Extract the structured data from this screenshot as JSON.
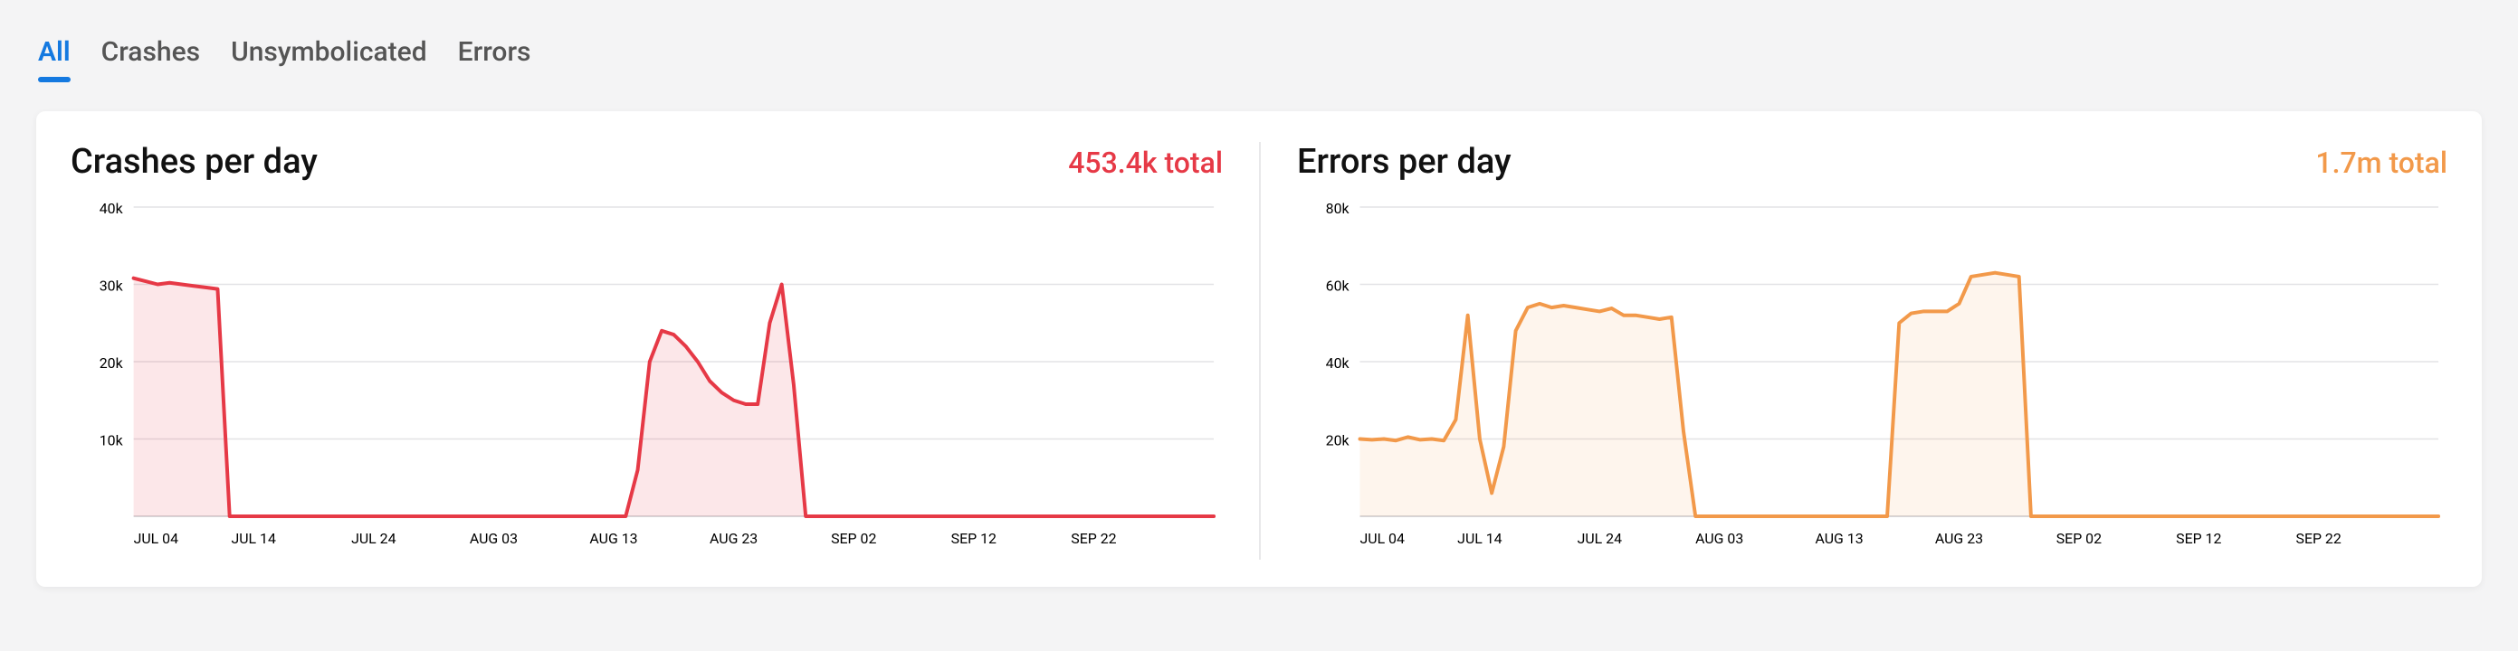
{
  "tabs": {
    "items": [
      {
        "label": "All",
        "active": true
      },
      {
        "label": "Crashes",
        "active": false
      },
      {
        "label": "Unsymbolicated",
        "active": false
      },
      {
        "label": "Errors",
        "active": false
      }
    ]
  },
  "colors": {
    "crashes_stroke": "#e63946",
    "crashes_fill": "rgba(230,57,70,0.12)",
    "errors_stroke": "#f2994a",
    "errors_fill": "rgba(242,153,74,0.10)",
    "tab_active": "#1479e0"
  },
  "chart_data": [
    {
      "id": "crashes",
      "type": "area",
      "title": "Crashes per day",
      "total_label": "453.4k total",
      "total_color": "#e63946",
      "ylim": [
        0,
        40000
      ],
      "yticks": [
        {
          "v": 10000,
          "label": "10k"
        },
        {
          "v": 20000,
          "label": "20k"
        },
        {
          "v": 30000,
          "label": "30k"
        },
        {
          "v": 40000,
          "label": "40k"
        }
      ],
      "xticks": [
        "JUL 04",
        "JUL 14",
        "JUL 24",
        "AUG 03",
        "AUG 13",
        "AUG 23",
        "SEP 02",
        "SEP 12",
        "SEP 22"
      ],
      "xmax_index": 90,
      "series": [
        {
          "name": "Crashes",
          "values": [
            30800,
            30400,
            30000,
            30200,
            30000,
            29800,
            29600,
            29400,
            0,
            0,
            0,
            0,
            0,
            0,
            0,
            0,
            0,
            0,
            0,
            0,
            0,
            0,
            0,
            0,
            0,
            0,
            0,
            0,
            0,
            0,
            0,
            0,
            0,
            0,
            0,
            0,
            0,
            0,
            0,
            0,
            0,
            0,
            6000,
            20000,
            24000,
            23500,
            22000,
            20000,
            17500,
            16000,
            15000,
            14500,
            14500,
            25000,
            30000,
            17000,
            0,
            0,
            0,
            0,
            0,
            0,
            0,
            0,
            0,
            0,
            0,
            0,
            0,
            0,
            0,
            0,
            0,
            0,
            0,
            0,
            0,
            0,
            0,
            0,
            0,
            0,
            0,
            0,
            0,
            0,
            0,
            0,
            0,
            0,
            0
          ]
        }
      ]
    },
    {
      "id": "errors",
      "type": "area",
      "title": "Errors per day",
      "total_label": "1.7m total",
      "total_color": "#f2994a",
      "ylim": [
        0,
        80000
      ],
      "yticks": [
        {
          "v": 20000,
          "label": "20k"
        },
        {
          "v": 40000,
          "label": "40k"
        },
        {
          "v": 60000,
          "label": "60k"
        },
        {
          "v": 80000,
          "label": "80k"
        }
      ],
      "xticks": [
        "JUL 04",
        "JUL 14",
        "JUL 24",
        "AUG 03",
        "AUG 13",
        "AUG 23",
        "SEP 02",
        "SEP 12",
        "SEP 22"
      ],
      "xmax_index": 90,
      "series": [
        {
          "name": "Errors",
          "values": [
            20000,
            19800,
            20000,
            19600,
            20500,
            19800,
            20000,
            19600,
            25000,
            52000,
            20000,
            6000,
            18000,
            48000,
            54000,
            55000,
            54000,
            54500,
            54000,
            53500,
            53000,
            53800,
            52000,
            52000,
            51500,
            51000,
            51500,
            22000,
            0,
            0,
            0,
            0,
            0,
            0,
            0,
            0,
            0,
            0,
            0,
            0,
            0,
            0,
            0,
            0,
            0,
            50000,
            52500,
            53000,
            53000,
            53000,
            55000,
            62000,
            62500,
            63000,
            62500,
            62000,
            0,
            0,
            0,
            0,
            0,
            0,
            0,
            0,
            0,
            0,
            0,
            0,
            0,
            0,
            0,
            0,
            0,
            0,
            0,
            0,
            0,
            0,
            0,
            0,
            0,
            0,
            0,
            0,
            0,
            0,
            0,
            0,
            0,
            0,
            0
          ]
        }
      ]
    }
  ]
}
